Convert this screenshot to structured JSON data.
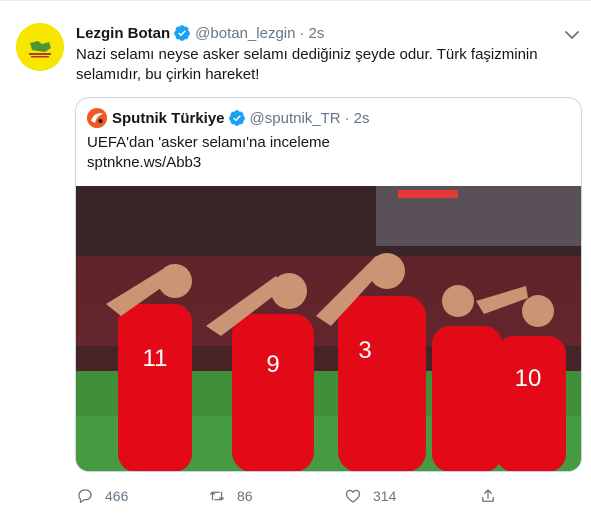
{
  "tweet": {
    "author_name": "Lezgin Botan",
    "author_handle": "@botan_lezgin",
    "separator": "·",
    "time": "2s",
    "text": "Nazi selamı neyse asker selamı dediğiniz şeyde odur. Türk faşizminin selamıdır, bu çirkin hareket!",
    "avatar_color": "#f7e600"
  },
  "quoted": {
    "author_name": "Sputnik Türkiye",
    "author_handle": "@sputnik_TR",
    "separator": "·",
    "time": "2s",
    "text_line1": "UEFA'dan 'asker selamı'na inceleme",
    "text_line2": "sptnkne.ws/Abb3",
    "avatar_color": "#f15a24"
  },
  "photo": {
    "shirt_numbers": [
      "11",
      "9",
      "3",
      "10"
    ],
    "shirt_color": "#e30a17",
    "pitch_color": "#3f8f3a"
  },
  "actions": {
    "reply_count": "466",
    "retweet_count": "86",
    "like_count": "314",
    "icons": [
      "reply-icon",
      "retweet-icon",
      "like-icon",
      "share-icon"
    ]
  },
  "colors": {
    "verified": "#1da1f2",
    "secondary_text": "#657786",
    "border": "#ccd6dd"
  }
}
